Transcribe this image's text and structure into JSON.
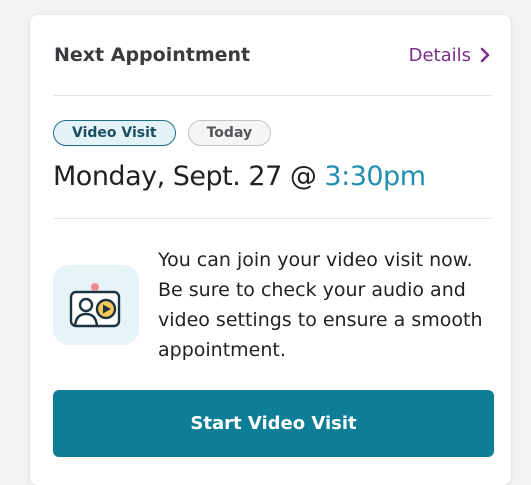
{
  "card": {
    "title": "Next Appointment",
    "details_label": "Details",
    "badges": {
      "visit_type": "Video Visit",
      "day": "Today"
    },
    "date": "Monday, Sept. 27 @ ",
    "time": "3:30pm",
    "message": "You can join your video visit now. Be sure to check your audio and video settings to ensure a smooth appointment.",
    "button_label": "Start Video Visit",
    "icons": {
      "details": "chevron-right-icon",
      "video_visit": "video-call-icon"
    },
    "colors": {
      "accent_link": "#7a2d8a",
      "time": "#1f8fb0",
      "button": "#0e7d96",
      "badge_video_border": "#1f6f8b"
    }
  }
}
